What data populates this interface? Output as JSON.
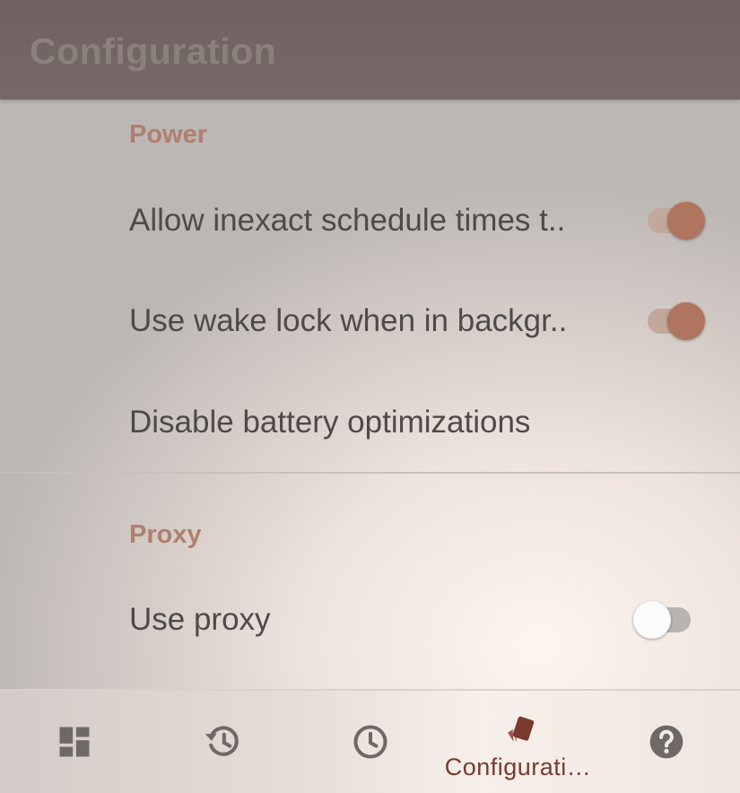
{
  "app_bar": {
    "title": "Configuration"
  },
  "sections": {
    "power": {
      "header": "Power",
      "items": [
        {
          "title": "Allow inexact schedule times t..",
          "toggle": "on"
        },
        {
          "title": "Use wake lock when in backgr..",
          "toggle": "on"
        },
        {
          "title": "Disable battery optimizations"
        }
      ]
    },
    "proxy": {
      "header": "Proxy",
      "items": [
        {
          "title": "Use proxy",
          "toggle": "off"
        }
      ]
    }
  },
  "bottom_nav": {
    "items": [
      {
        "icon": "dashboard-icon"
      },
      {
        "icon": "history-icon"
      },
      {
        "icon": "clock-icon"
      },
      {
        "icon": "configuration-icon",
        "label": "Configurati…",
        "active": true
      },
      {
        "icon": "help-icon"
      }
    ]
  },
  "colors": {
    "accent": "#b0755f",
    "section_header": "#b0806d",
    "app_bar": "#736563",
    "nav_active": "#7a3a2f",
    "nav_icon": "#6e6866"
  }
}
